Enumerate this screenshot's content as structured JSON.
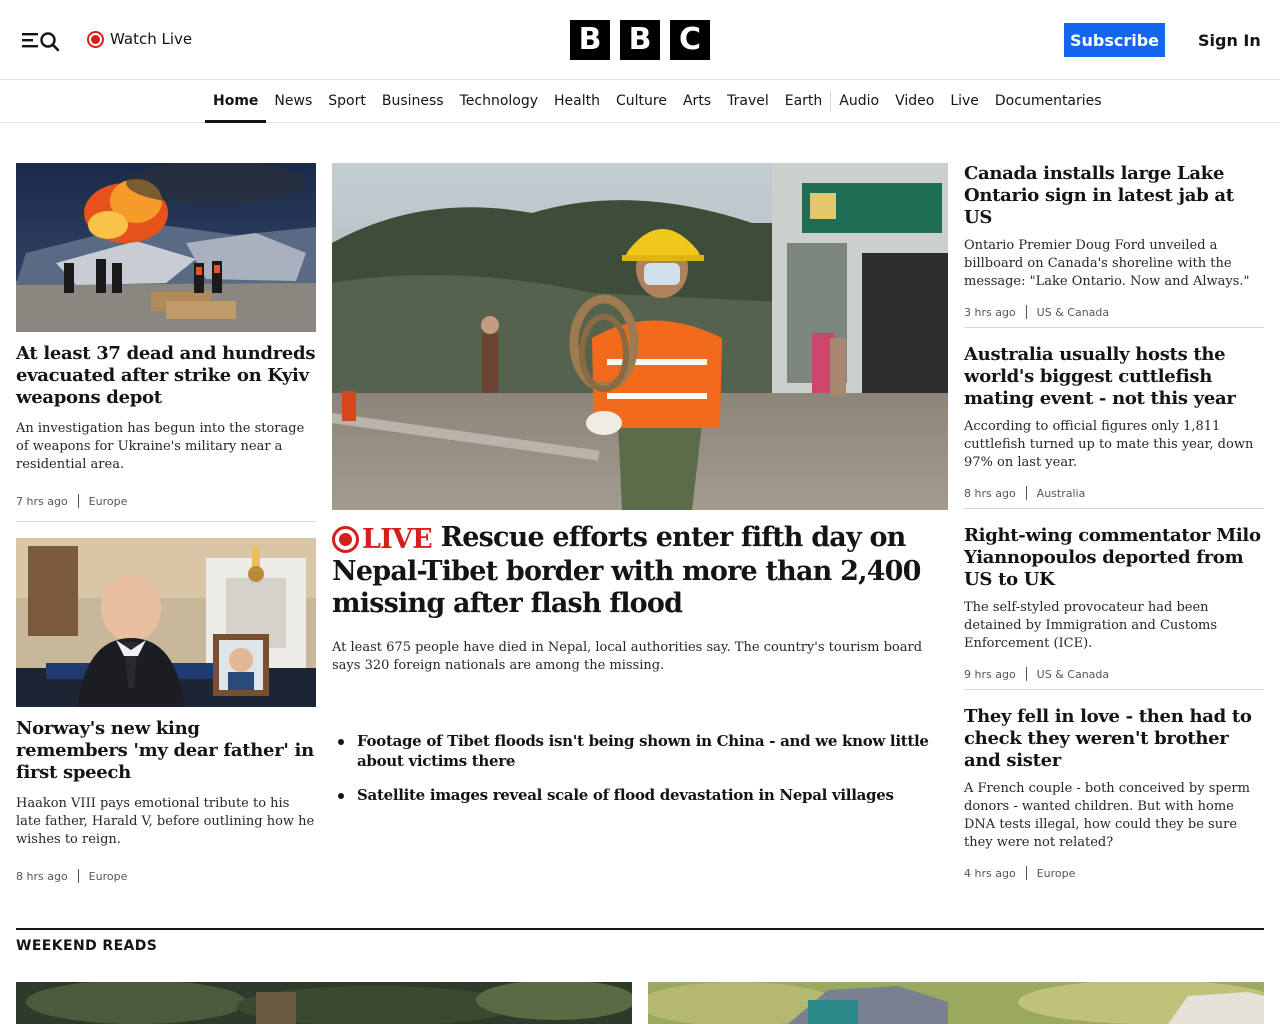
{
  "header": {
    "watch_live": "Watch Live",
    "logo_letters": [
      "B",
      "B",
      "C"
    ],
    "subscribe": "Subscribe",
    "sign_in": "Sign In"
  },
  "nav": {
    "items": [
      "Home",
      "News",
      "Sport",
      "Business",
      "Technology",
      "Health",
      "Culture",
      "Arts",
      "Travel",
      "Earth",
      "Audio",
      "Video",
      "Live",
      "Documentaries"
    ],
    "active": "Home"
  },
  "left": [
    {
      "headline": "At least 37 dead and hundreds evacuated after strike on Kyiv weapons depot",
      "summary": "An investigation has begun into the storage of weapons for Ukraine's military near a residential area.",
      "time": "7 hrs ago",
      "tag": "Europe"
    },
    {
      "headline": "Norway's new king remembers 'my dear father' in first speech",
      "summary": "Haakon VIII pays emotional tribute to his late father, Harald V, before outlining how he wishes to reign.",
      "time": "8 hrs ago",
      "tag": "Europe"
    }
  ],
  "main": {
    "live_label": "LIVE",
    "headline": "Rescue efforts enter fifth day on Nepal-Tibet border with more than 2,400 missing after flash flood",
    "summary": "At least 675 people have died in Nepal, local authorities say. The country's tourism board says 320 foreign nationals are among the missing.",
    "related": [
      "Footage of Tibet floods isn't being shown in China - and we know little about victims there",
      "Satellite images reveal scale of flood devastation in Nepal villages"
    ]
  },
  "right": [
    {
      "headline": "Canada installs large Lake Ontario sign in latest jab at US",
      "summary": "Ontario Premier Doug Ford unveiled a billboard on Canada's shoreline with the message: \"Lake Ontario. Now and Always.\"",
      "time": "3 hrs ago",
      "tag": "US & Canada"
    },
    {
      "headline": "Australia usually hosts the world's biggest cuttlefish mating event - not this year",
      "summary": "According to official figures only 1,811 cuttlefish turned up to mate this year, down 97% on last year.",
      "time": "8 hrs ago",
      "tag": "Australia"
    },
    {
      "headline": "Right-wing commentator Milo Yiannopoulos deported from US to UK",
      "summary": "The self-styled provocateur had been detained by Immigration and Customs Enforcement (ICE).",
      "time": "9 hrs ago",
      "tag": "US & Canada"
    },
    {
      "headline": "They fell in love - then had to check they weren't brother and sister",
      "summary": "A French couple - both conceived by sperm donors - wanted children. But with home DNA tests illegal, how could they be sure they were not related?",
      "time": "4 hrs ago",
      "tag": "Europe"
    }
  ],
  "weekend": {
    "title": "WEEKEND READS"
  },
  "colors": {
    "live_red": "#d4201d",
    "subscribe_blue": "#1466ef",
    "text": "#141414"
  },
  "icons": [
    "menu-icon",
    "search-icon",
    "live-dot-icon"
  ]
}
